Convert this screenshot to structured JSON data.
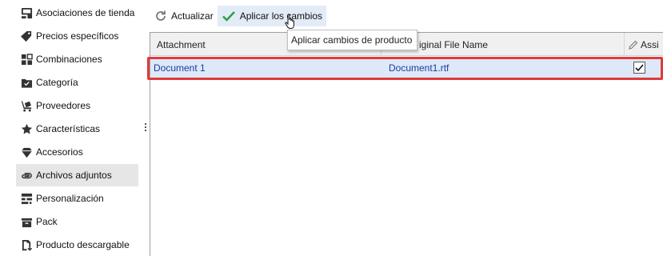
{
  "sidebar": {
    "items": [
      {
        "label": "Asociaciones de tienda",
        "icon": "store-associations-icon"
      },
      {
        "label": "Precios específicos",
        "icon": "price-tag-icon"
      },
      {
        "label": "Combinaciones",
        "icon": "combinations-icon"
      },
      {
        "label": "Categoría",
        "icon": "category-folder-icon"
      },
      {
        "label": "Proveedores",
        "icon": "suppliers-icon"
      },
      {
        "label": "Características",
        "icon": "star-icon"
      },
      {
        "label": "Accesorios",
        "icon": "diamond-icon"
      },
      {
        "label": "Archivos adjuntos",
        "icon": "paperclip-icon",
        "active": true
      },
      {
        "label": "Personalización",
        "icon": "customization-icon"
      },
      {
        "label": "Pack",
        "icon": "pack-icon"
      },
      {
        "label": "Producto descargable",
        "icon": "downloadable-product-icon"
      }
    ]
  },
  "toolbar": {
    "refresh_label": "Actualizar",
    "apply_label": "Aplicar los cambios"
  },
  "tooltip": {
    "text": "Aplicar cambios de producto"
  },
  "grid": {
    "columns": {
      "attachment": "Attachment",
      "original_file_name": "iginal File Name",
      "assigned": "Assi"
    },
    "rows": [
      {
        "attachment": "Document 1",
        "original_file_name": "Document1.rtf",
        "assigned": true
      }
    ]
  },
  "colors": {
    "highlight_border": "#e03a3a",
    "row_selected": "#dde8f8",
    "link_text": "#1a3d9e",
    "apply_check": "#2e9e3e"
  }
}
